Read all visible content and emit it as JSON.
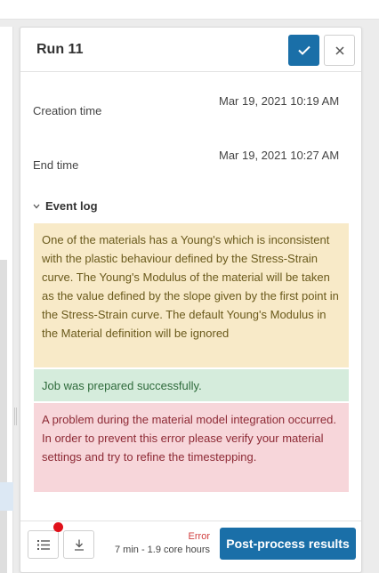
{
  "run": {
    "title": "Run 11"
  },
  "details": {
    "creation_label": "Creation time",
    "creation_value": "Mar 19, 2021 10:19 AM",
    "end_label": "End time",
    "end_value": "Mar 19, 2021 10:27 AM"
  },
  "event_log": {
    "title": "Event log",
    "entries": [
      {
        "level": "warning",
        "text": "One of the materials has a Young's which is inconsistent with the plastic behaviour defined by the Stress-Strain curve. The Young's Modulus of the material will be taken as the value defined by the slope given by the first point in the Stress-Strain curve. The default Young's Modulus in the Material definition will be ignored"
      },
      {
        "level": "success",
        "text": "Job was prepared successfully."
      },
      {
        "level": "error",
        "text": "A problem during the material model integration occurred. In order to prevent this error please verify your material settings and try to refine the timestepping."
      }
    ]
  },
  "footer": {
    "status": "Error",
    "duration": "7 min - 1.9 core hours",
    "post_process_label": "Post-process results"
  },
  "icons": {
    "confirm": "check-icon",
    "close": "close-icon",
    "collapse": "chevron-down-icon",
    "log_list": "list-icon",
    "download": "download-icon"
  },
  "colors": {
    "primary": "#1a6fa8",
    "warning_bg": "#f8eac8",
    "success_bg": "#d5ecdc",
    "error_bg": "#f7d6da",
    "notification": "#e0111a",
    "error_text": "#d14040"
  }
}
